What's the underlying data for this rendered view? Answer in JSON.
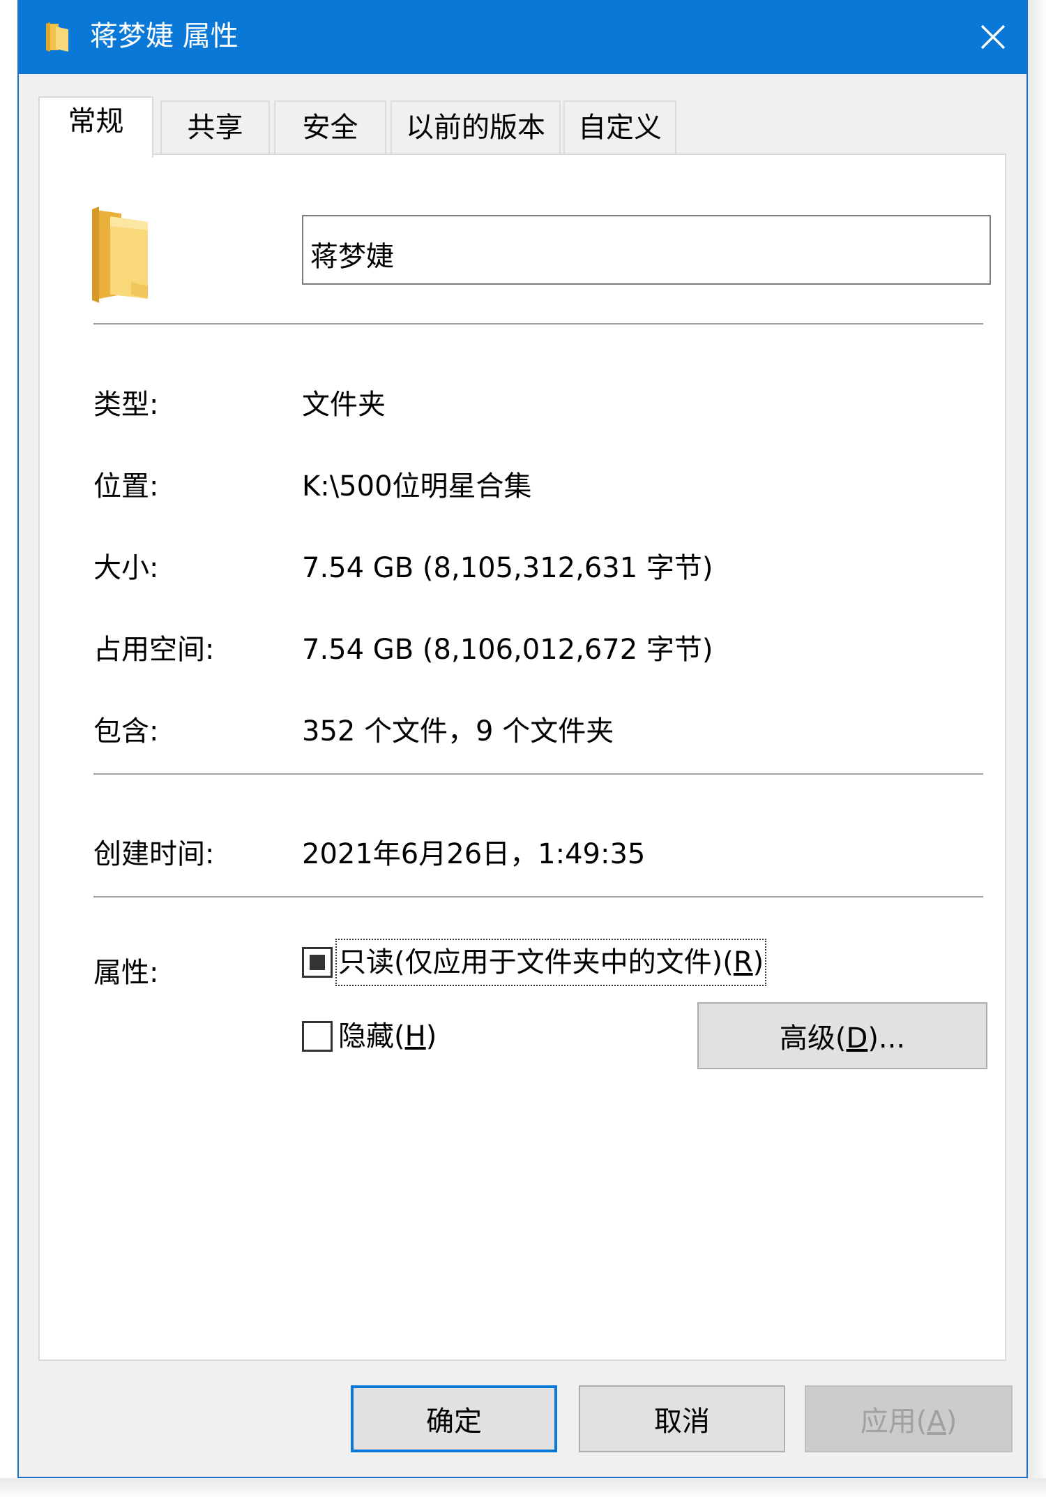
{
  "window": {
    "title": "蒋梦婕 属性",
    "close_icon": "close-icon",
    "colors": {
      "titlebar": "#0a78d7",
      "title_text": "#ffffff"
    }
  },
  "tabs": [
    {
      "label": "常规",
      "active": true
    },
    {
      "label": "共享",
      "active": false
    },
    {
      "label": "安全",
      "active": false
    },
    {
      "label": "以前的版本",
      "active": false
    },
    {
      "label": "自定义",
      "active": false
    }
  ],
  "general": {
    "folder_icon": "folder-icon",
    "name_value": "蒋梦婕",
    "rows": [
      {
        "label": "类型:",
        "value": "文件夹"
      },
      {
        "label": "位置:",
        "value": "K:\\500位明星合集"
      },
      {
        "label": "大小:",
        "value": "7.54 GB (8,105,312,631 字节)"
      },
      {
        "label": "占用空间:",
        "value": "7.54 GB (8,106,012,672 字节)"
      },
      {
        "label": "包含:",
        "value": "352 个文件，9 个文件夹"
      },
      {
        "label": "创建时间:",
        "value": "2021年6月26日，1:49:35"
      }
    ],
    "attributes_label": "属性:",
    "readonly": {
      "text": "只读(仅应用于文件夹中的文件)(",
      "mnemonic": "R",
      "suffix": ")",
      "state": "indeterminate"
    },
    "hidden": {
      "text": "隐藏(",
      "mnemonic": "H",
      "suffix": ")",
      "state": "unchecked"
    },
    "advanced_button": {
      "text": "高级(",
      "mnemonic": "D",
      "suffix": ")..."
    }
  },
  "footer": {
    "ok": "确定",
    "cancel": "取消",
    "apply": {
      "text": "应用(",
      "mnemonic": "A",
      "suffix": ")",
      "enabled": false
    }
  }
}
